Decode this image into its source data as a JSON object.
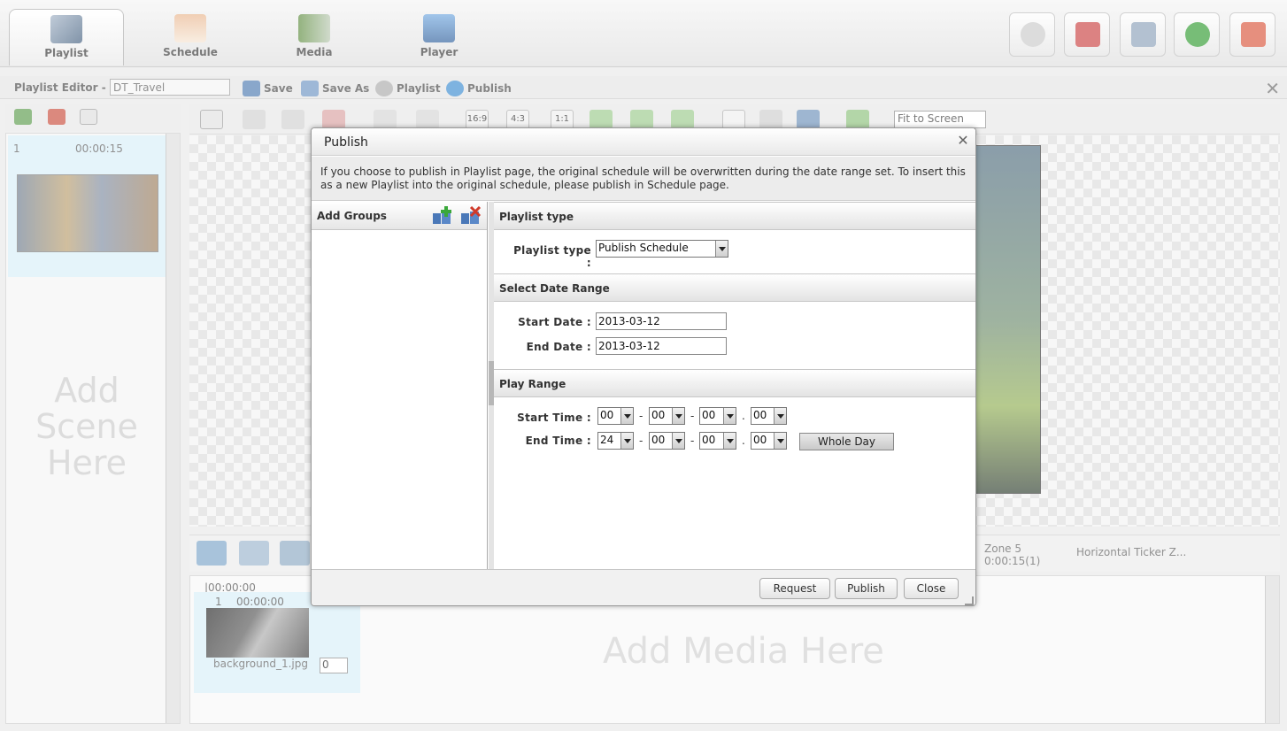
{
  "nav": {
    "tabs": [
      {
        "label": "Playlist",
        "icon": "playlist-icon"
      },
      {
        "label": "Schedule",
        "icon": "calendar-icon"
      },
      {
        "label": "Media",
        "icon": "film-icon"
      },
      {
        "label": "Player",
        "icon": "monitor-icon"
      }
    ],
    "right_buttons": [
      "settings-icon",
      "alarm-icon",
      "monitor-search-icon",
      "help-icon",
      "logout-icon"
    ]
  },
  "editor": {
    "label": "Playlist Editor -",
    "name": "DT_Travel",
    "save": "Save",
    "save_as": "Save As",
    "playlist": "Playlist",
    "publish": "Publish"
  },
  "toolbar": {
    "ratio_16_9": "16:9",
    "ratio_4_3": "4:3",
    "ratio_1_1": "1:1",
    "zoom": "Fit to Screen"
  },
  "scenes": {
    "item_number": "1",
    "item_duration": "00:00:15",
    "placeholder": "Add Scene Here"
  },
  "zones": {
    "zone5_name": "Zone 5",
    "zone5_time": "0:00:15(1)",
    "ticker": "Horizontal Ticker Z..."
  },
  "timeline": {
    "time": "|00:00:00",
    "media_number": "1",
    "media_duration": "00:00:00",
    "media_name": "background_1.jpg",
    "media_select": "0",
    "placeholder": "Add Media Here"
  },
  "dialog": {
    "title": "Publish",
    "notice": "If you choose to publish in Playlist page, the original schedule will be overwritten during the date range set. To insert this as a new Playlist into the original schedule, please publish in Schedule page.",
    "groups_title": "Add Groups",
    "sections": {
      "playlist_type": "Playlist type",
      "date_range": "Select Date Range",
      "play_range": "Play Range"
    },
    "playlist_type_label": "Playlist type :",
    "playlist_type_value": "Publish Schedule",
    "start_date_label": "Start Date :",
    "start_date": "2013-03-12",
    "end_date_label": "End Date :",
    "end_date": "2013-03-12",
    "start_time_label": "Start Time :",
    "end_time_label": "End Time :",
    "start_time": [
      "00",
      "00",
      "00",
      "00"
    ],
    "end_time": [
      "24",
      "00",
      "00",
      "00"
    ],
    "time_sep": [
      "-",
      "-",
      "."
    ],
    "whole_day": "Whole Day",
    "buttons": {
      "request": "Request",
      "publish": "Publish",
      "close": "Close"
    }
  }
}
